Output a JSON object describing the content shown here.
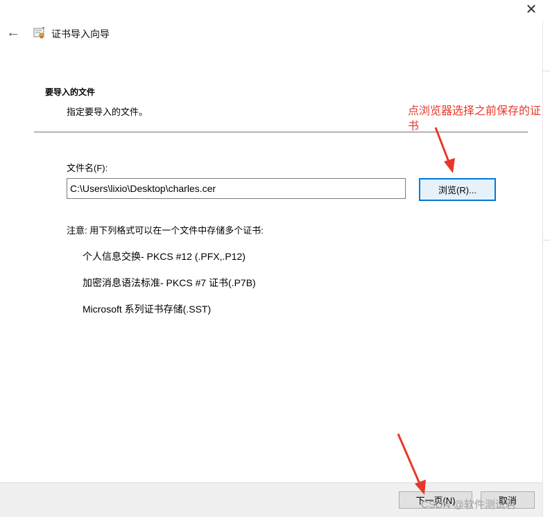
{
  "window": {
    "close_glyph": "✕",
    "back_glyph": "←",
    "title": "证书导入向导"
  },
  "page": {
    "heading": "要导入的文件",
    "subheading": "指定要导入的文件。"
  },
  "file_section": {
    "label": "文件名(F):",
    "value": "C:\\Users\\lixio\\Desktop\\charles.cer",
    "browse_label": "浏览(R)..."
  },
  "formats": {
    "note": "注意: 用下列格式可以在一个文件中存储多个证书:",
    "items": [
      "个人信息交换- PKCS #12 (.PFX,.P12)",
      "加密消息语法标准- PKCS #7 证书(.P7B)",
      "Microsoft 系列证书存储(.SST)"
    ]
  },
  "footer": {
    "next_label": "下一页(N)",
    "cancel_label": "取消"
  },
  "annotations": {
    "browse_hint": "点浏览器选择之前保存的证书",
    "color": "#e8372a"
  },
  "watermark": "CSDN @软件测试君"
}
